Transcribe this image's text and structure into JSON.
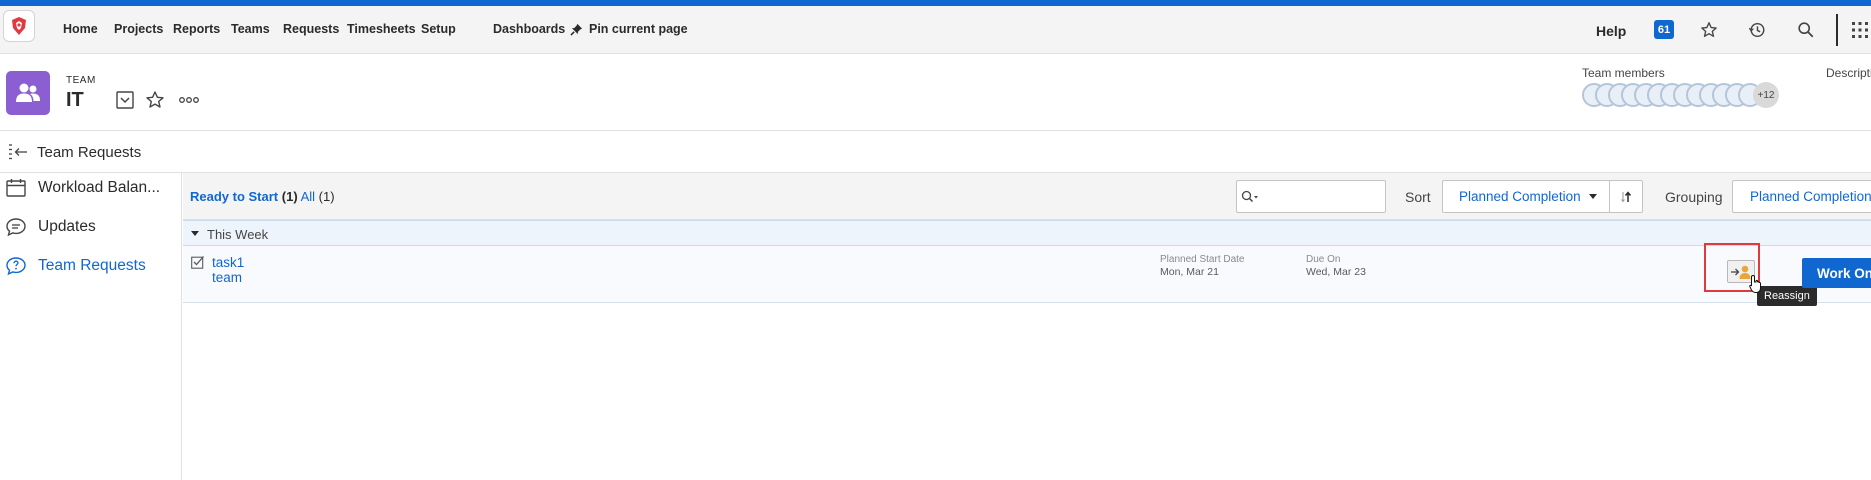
{
  "nav": {
    "items": [
      "Home",
      "Projects",
      "Reports",
      "Teams",
      "Requests",
      "Timesheets",
      "Setup",
      "Dashboards"
    ],
    "pin_label": "Pin current page",
    "help_label": "Help",
    "notifications_count": "61",
    "brand_color": "#1167d0"
  },
  "header": {
    "type_label": "TEAM",
    "team_name": "IT",
    "team_members_label": "Team members",
    "description_label": "Description",
    "more_members": "+12",
    "avatar_color": "#8b5ed1"
  },
  "panel": {
    "title": "Team Requests"
  },
  "sidebar": {
    "items": [
      {
        "label": "Workload Balan...",
        "icon": "calendar-icon"
      },
      {
        "label": "Updates",
        "icon": "speech-bubble-icon"
      },
      {
        "label": "Team Requests",
        "icon": "question-bubble-icon"
      }
    ]
  },
  "toolbar": {
    "filter_ready": "Ready to Start",
    "filter_ready_count": "(1)",
    "filter_all": "All",
    "filter_all_count": "(1)",
    "sort_label": "Sort",
    "sort_value": "Planned Completion",
    "grouping_label": "Grouping",
    "grouping_value": "Planned Completion"
  },
  "group": {
    "label": "This Week"
  },
  "task": {
    "name": "task1",
    "project": "team",
    "planned_start_label": "Planned Start Date",
    "planned_start_value": "Mon, Mar 21",
    "due_label": "Due On",
    "due_value": "Wed, Mar 23",
    "tooltip": "Reassign",
    "work_on_label": "Work On It"
  }
}
